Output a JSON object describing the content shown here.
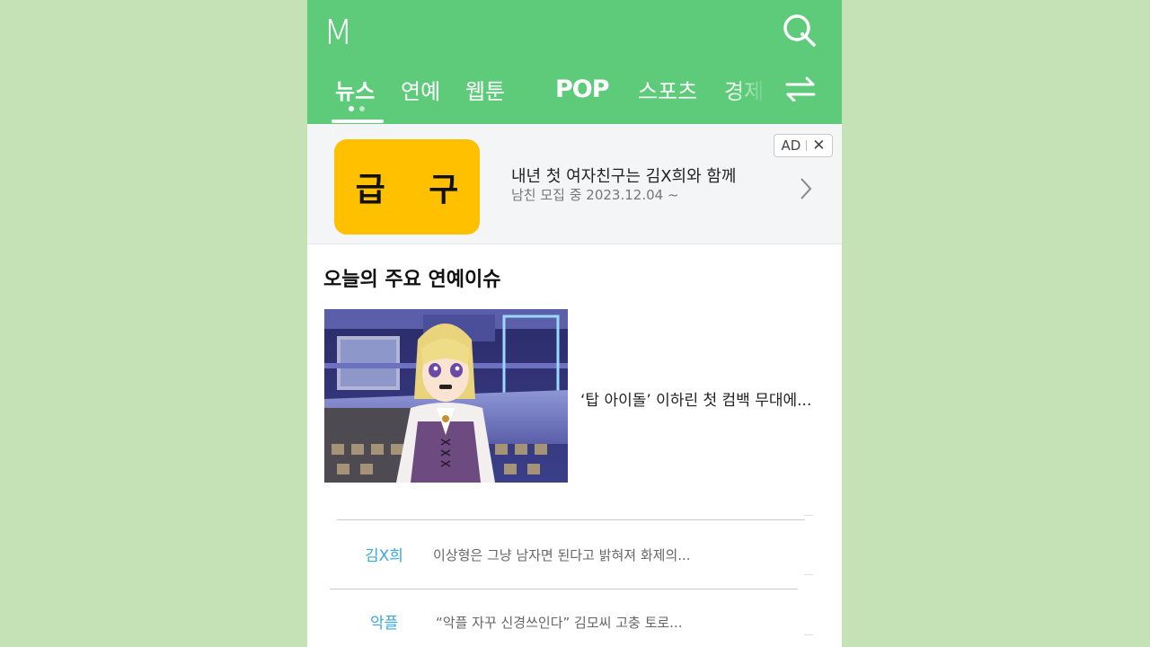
{
  "header": {
    "logo": "M",
    "tabs": [
      {
        "label": "뉴스",
        "active": true
      },
      {
        "label": "연예",
        "active": false
      },
      {
        "label": "웹툰",
        "active": false
      },
      {
        "label": "POP",
        "active": false
      },
      {
        "label": "스포츠",
        "active": false
      },
      {
        "label": "경제",
        "active": false
      }
    ],
    "icons": {
      "search": "search-icon",
      "swap": "swap-arrows-icon"
    },
    "accent_color": "#5ecb7a"
  },
  "ad": {
    "thumb_text": "급 구",
    "title": "내년 첫 여자친구는 김X희와 함께",
    "subtitle": "남친 모집 중 2023.12.04 ~",
    "badge": "AD",
    "close_symbol": "✕"
  },
  "section": {
    "title": "오늘의 주요 연예이슈",
    "feature_title": "‘탑 아이돌’ 이하린 첫 컴백 무대에...",
    "issues": [
      {
        "keyword": "김X희",
        "text": "이상형은 그냥 남자면 된다고 밝혀져 화제의..."
      },
      {
        "keyword": "악플",
        "text": "“악플 자꾸 신경쓰인다” 김모씨 고충 토로..."
      }
    ]
  }
}
